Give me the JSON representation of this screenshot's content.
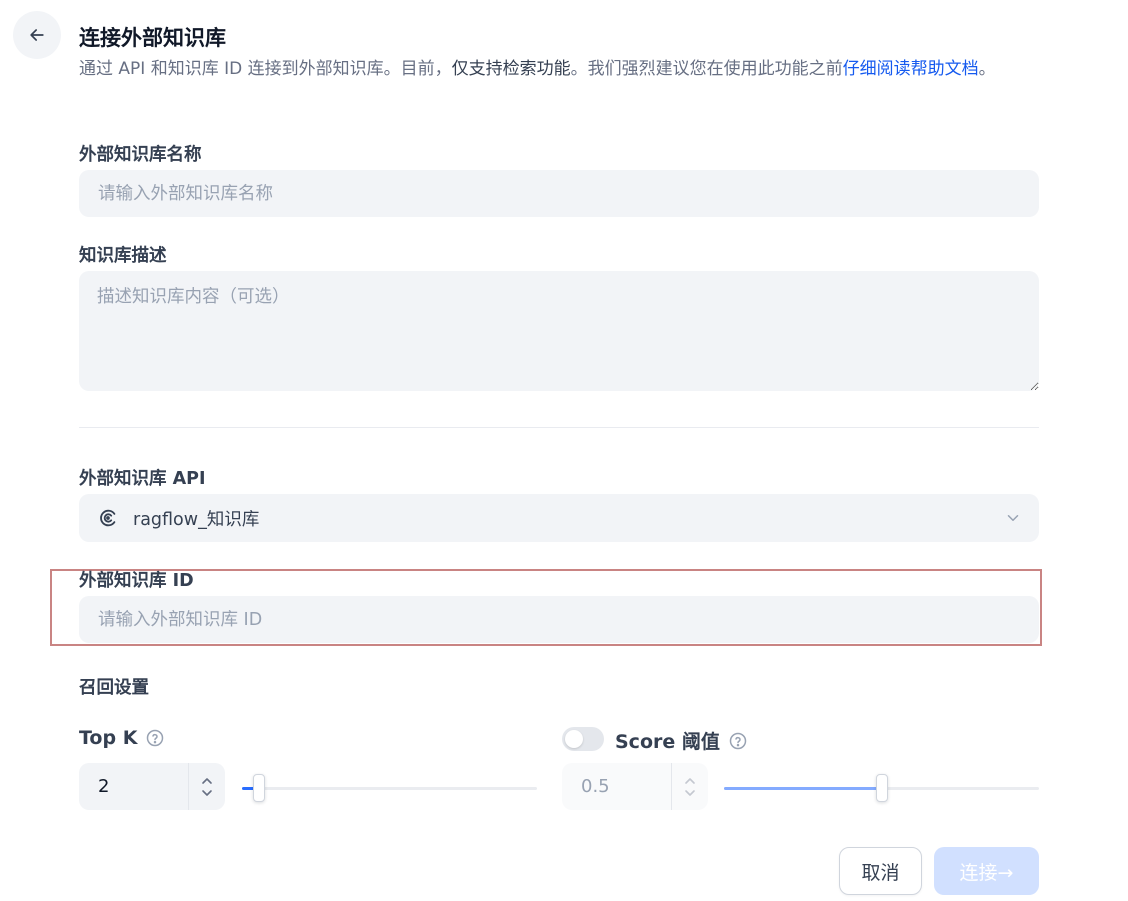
{
  "header": {
    "title": "连接外部知识库",
    "description_prefix": "通过 API 和知识库 ID 连接到外部知识库。目前，",
    "description_strong": "仅支持检索功能",
    "description_middle": "。我们强烈建议您在使用此功能之前",
    "description_link": "仔细阅读帮助文档",
    "description_suffix": "。"
  },
  "form": {
    "name_label": "外部知识库名称",
    "name_placeholder": "请输入外部知识库名称",
    "desc_label": "知识库描述",
    "desc_placeholder": "描述知识库内容（可选）",
    "api_label": "外部知识库 API",
    "api_selected": "ragflow_知识库",
    "id_label": "外部知识库 ID",
    "id_placeholder": "请输入外部知识库 ID"
  },
  "retrieval": {
    "section_label": "召回设置",
    "top_k_label": "Top K",
    "top_k_value": "2",
    "top_k_fraction": 0.04,
    "score_label": "Score 阈值",
    "score_value": "0.5",
    "score_fraction": 0.5,
    "score_enabled": false
  },
  "actions": {
    "cancel_label": "取消",
    "connect_label": "连接→"
  },
  "colors": {
    "accent": "#155aef",
    "slider_fill_active": "#296dff",
    "slider_fill_disabled": "#84abff"
  }
}
